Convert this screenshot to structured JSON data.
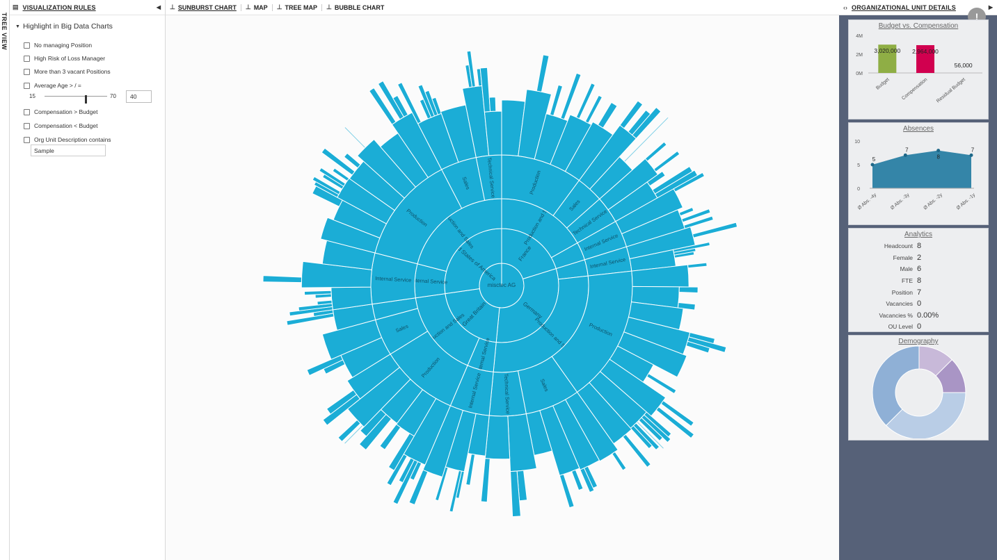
{
  "tree_tab": {
    "label": "TREE VIEW"
  },
  "rules": {
    "header": "VISUALIZATION RULES",
    "section": "Highlight in Big Data Charts",
    "items": [
      {
        "label": "No managing Position",
        "checked": false
      },
      {
        "label": "High Risk of Loss Manager",
        "checked": false
      },
      {
        "label": "More than 3 vacant Positions",
        "checked": false
      },
      {
        "label": "Average Age > / =",
        "checked": false
      },
      {
        "label": "Compensation > Budget",
        "checked": false
      },
      {
        "label": "Compensation < Budget",
        "checked": false
      },
      {
        "label": "Org Unit Description contains",
        "checked": false
      }
    ],
    "age_slider": {
      "min": "15",
      "max": "70",
      "value": "40"
    },
    "desc_value": "Sample"
  },
  "tabs": [
    {
      "label": "SUNBURST CHART",
      "active": true
    },
    {
      "label": "MAP",
      "active": false
    },
    {
      "label": "TREE MAP",
      "active": false
    },
    {
      "label": "BUBBLE CHART",
      "active": false
    }
  ],
  "sunburst": {
    "root": "misctec AG",
    "color": "#1badd6",
    "countries": [
      {
        "label": "France",
        "weight": 1.0,
        "children": [
          {
            "label": "Production and Sales",
            "weight": 1.0,
            "children": [
              {
                "label": "Production",
                "weight": 3
              },
              {
                "label": "Sales",
                "weight": 1
              },
              {
                "label": "Technical Service",
                "weight": 1
              }
            ]
          },
          {
            "label": "Internal Service",
            "weight": 0.2,
            "children": [
              {
                "label": "Internal Service",
                "weight": 1
              }
            ]
          }
        ]
      },
      {
        "label": "Germany",
        "weight": 1.55,
        "children": [
          {
            "label": "Internal Service",
            "weight": 0.15,
            "children": [
              {
                "label": "Internal Service",
                "weight": 1
              }
            ]
          },
          {
            "label": "Production and Sales",
            "weight": 1.4,
            "children": [
              {
                "label": "Production",
                "weight": 3
              },
              {
                "label": "Sales",
                "weight": 1.2
              },
              {
                "label": "Technical Service",
                "weight": 0.8
              }
            ]
          }
        ]
      },
      {
        "label": "Great Britain",
        "weight": 1.05,
        "children": [
          {
            "label": "Internal Service",
            "weight": 0.3,
            "children": [
              {
                "label": "Internal Service",
                "weight": 1
              }
            ]
          },
          {
            "label": "Production and Sales",
            "weight": 1.0,
            "children": [
              {
                "label": "Production",
                "weight": 3
              },
              {
                "label": "Sales",
                "weight": 1.4
              },
              {
                "label": "Technical Service",
                "weight": 0.6
              }
            ]
          }
        ]
      },
      {
        "label": "United States of America",
        "weight": 1.35,
        "children": [
          {
            "label": "Internal Service",
            "weight": 0.3,
            "children": [
              {
                "label": "Internal Service",
                "weight": 1
              }
            ]
          },
          {
            "label": "Production and Sales",
            "weight": 1.0,
            "children": [
              {
                "label": "Production",
                "weight": 3
              },
              {
                "label": "Sales",
                "weight": 1
              },
              {
                "label": "Technical Service",
                "weight": 0.7
              }
            ]
          }
        ]
      }
    ]
  },
  "details": {
    "header": "ORGANIZATIONAL UNIT DETAILS",
    "alert": "!",
    "budget": {
      "title": "Budget vs. Compensation",
      "y_ticks": [
        "4M",
        "2M",
        "0M"
      ],
      "bars": [
        {
          "label": "Budget",
          "value": 3020000,
          "text": "3,020,000",
          "color": "#8fae45"
        },
        {
          "label": "Compensation",
          "value": 2964000,
          "text": "2,964,000",
          "color": "#d1004f"
        },
        {
          "label": "Residual Budget",
          "value": 56000,
          "text": "56,000",
          "color": "#cccccc"
        }
      ],
      "ymax": 4000000
    },
    "absences": {
      "title": "Absences",
      "y_ticks": [
        "10",
        "5",
        "0"
      ],
      "ymax": 10,
      "points": [
        {
          "label": "Ø Abs. -4y",
          "value": 5
        },
        {
          "label": "Ø Abs. -3y",
          "value": 7
        },
        {
          "label": "Ø Abs. -2y",
          "value": 8
        },
        {
          "label": "Ø Abs. -1y",
          "value": 7
        }
      ],
      "color": "#2a7ea3"
    },
    "analytics": {
      "title": "Analytics",
      "rows": [
        {
          "k": "Headcount",
          "v": "8"
        },
        {
          "k": "Female",
          "v": "2"
        },
        {
          "k": "Male",
          "v": "6"
        },
        {
          "k": "FTE",
          "v": "8"
        },
        {
          "k": "Position",
          "v": "7"
        },
        {
          "k": "Vacancies",
          "v": "0"
        },
        {
          "k": "Vacancies %",
          "v": "0.00%"
        },
        {
          "k": "OU Level",
          "v": "0"
        }
      ]
    },
    "demography": {
      "title": "Demography",
      "slices": [
        {
          "value": 12.5,
          "color": "#c8b9d9"
        },
        {
          "value": 12.5,
          "color": "#a995c5"
        },
        {
          "value": 37.5,
          "color": "#b9cde6"
        },
        {
          "value": 37.5,
          "color": "#8fb0d6"
        }
      ]
    }
  }
}
